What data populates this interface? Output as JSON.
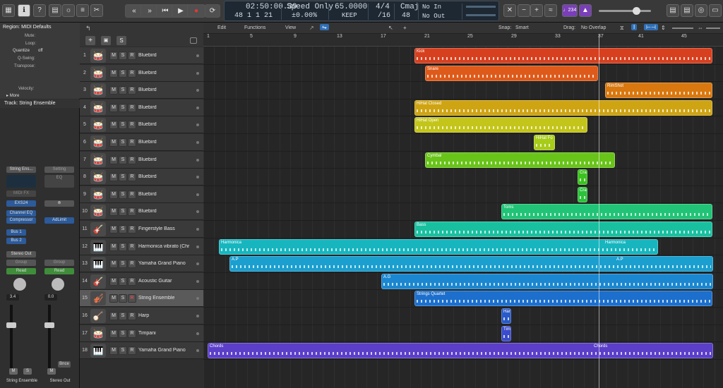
{
  "toolbar": {
    "transport": {
      "rewind": "«",
      "forward": "»",
      "to_start": "⏮",
      "play": "▶",
      "record": "●",
      "cycle": "⟳"
    },
    "position_time": "02:50:00.39",
    "position_bars": "48  1  1    21",
    "mode": "Speed Only",
    "speed_pct": "±0.00%",
    "tempo": "65.0000",
    "tempo_mode": "KEEP",
    "signature": "4/4",
    "division": "/16",
    "key": "Cmaj",
    "key_sub": "48",
    "in": "No In",
    "out": "No Out",
    "count_in": "♩234",
    "icons": {
      "library": "▦",
      "info": "ℹ",
      "help": "?",
      "editors": "▤",
      "smart_controls": "☼",
      "mixer": "≡",
      "scissors": "✂",
      "notepad": "▤",
      "loops": "◎",
      "browser": "▭"
    }
  },
  "inspector": {
    "region_title": "Region: MIDI Defaults",
    "rows": [
      "Mute:",
      "Loop:",
      "Quantize",
      "Q-Swing:",
      "Transpose:",
      "Velocity:",
      "More"
    ],
    "quantize_value": "off",
    "track_title": "Track:  String Ensemble"
  },
  "strip_left": {
    "setting": "String Ens...",
    "eq": "",
    "midi_fx": "MIDI FX",
    "instrument": "EXS24",
    "inserts": [
      "Channel EQ",
      "Compressor"
    ],
    "sends": [
      "Bus 1",
      "Bus 2"
    ],
    "output": "Stereo Out",
    "group": "Group",
    "automation": "Read",
    "volume": "3.4",
    "mute": "M",
    "solo": "S",
    "name": "String Ensemble"
  },
  "strip_right": {
    "setting": "Setting",
    "eq": "EQ",
    "insert": "AdLimit",
    "group": "Group",
    "automation": "Read",
    "volume": "0.0",
    "mute": "M",
    "bounce": "Bnce",
    "name": "Stereo Out"
  },
  "tracks_header": {
    "add": "+",
    "folder": "▣",
    "solo": "S"
  },
  "menu": {
    "edit": "Edit",
    "functions": "Functions",
    "view": "View",
    "snap_label": "Snap:",
    "snap": "Smart",
    "drag_label": "Drag:",
    "drag": "No Overlap"
  },
  "ruler": [
    "1",
    "5",
    "9",
    "13",
    "17",
    "21",
    "25",
    "29",
    "33",
    "37",
    "41",
    "45"
  ],
  "track_buttons": {
    "m": "M",
    "s": "S",
    "r": "R"
  },
  "tracks": [
    {
      "n": "1",
      "name": "Bluebird"
    },
    {
      "n": "2",
      "name": "Bluebird"
    },
    {
      "n": "3",
      "name": "Bluebird"
    },
    {
      "n": "4",
      "name": "Bluebird"
    },
    {
      "n": "5",
      "name": "Bluebird"
    },
    {
      "n": "6",
      "name": "Bluebird"
    },
    {
      "n": "7",
      "name": "Bluebird"
    },
    {
      "n": "8",
      "name": "Bluebird"
    },
    {
      "n": "9",
      "name": "Bluebird"
    },
    {
      "n": "10",
      "name": "Bluebird"
    },
    {
      "n": "11",
      "name": "Fingerstyle Bass"
    },
    {
      "n": "12",
      "name": "Harmonica vibrato (Chr"
    },
    {
      "n": "13",
      "name": "Yamaha Grand Piano"
    },
    {
      "n": "14",
      "name": "Acoustic Guitar"
    },
    {
      "n": "15",
      "name": "String Ensemble"
    },
    {
      "n": "16",
      "name": "Harp"
    },
    {
      "n": "17",
      "name": "Timpani"
    },
    {
      "n": "18",
      "name": "Yamaha Grand Piano"
    }
  ],
  "regions": [
    {
      "t": 0,
      "label": "Kick",
      "c": "#d7401f"
    },
    {
      "t": 1,
      "label": "Snare",
      "c": "#de5a1a"
    },
    {
      "t": 2,
      "label": "RimShot",
      "c": "#d9780f"
    },
    {
      "t": 3,
      "label": "HiHat Closed",
      "c": "#cfa413"
    },
    {
      "t": 4,
      "label": "HiHat Open",
      "c": "#c4c51a"
    },
    {
      "t": 5,
      "label": "HiHat Fo",
      "c": "#a7cc1a"
    },
    {
      "t": 6,
      "label": "Cymbal",
      "c": "#69c41a"
    },
    {
      "t": 7,
      "label": "Cra",
      "c": "#3cc21f"
    },
    {
      "t": 8,
      "label": "Cra",
      "c": "#2cc23b"
    },
    {
      "t": 9,
      "label": "Toms",
      "c": "#21c476"
    },
    {
      "t": 10,
      "label": "Bass",
      "c": "#19c0a0"
    },
    {
      "t": 11,
      "label": "Harmonica",
      "label2": "Harmonica",
      "c": "#17b6bf"
    },
    {
      "t": 12,
      "label": "A.P",
      "label2": "A.P",
      "c": "#1a9fcf"
    },
    {
      "t": 13,
      "label": "A.G",
      "c": "#1b87d0"
    },
    {
      "t": 14,
      "label": "Strings Quartet",
      "c": "#1c6fcc"
    },
    {
      "t": 15,
      "label": "Har",
      "c": "#2a5ac8"
    },
    {
      "t": 16,
      "label": "Tim",
      "c": "#3a4ccb"
    },
    {
      "t": 17,
      "label": "Chords",
      "label2": "Chords",
      "c": "#5b3fc9"
    }
  ]
}
